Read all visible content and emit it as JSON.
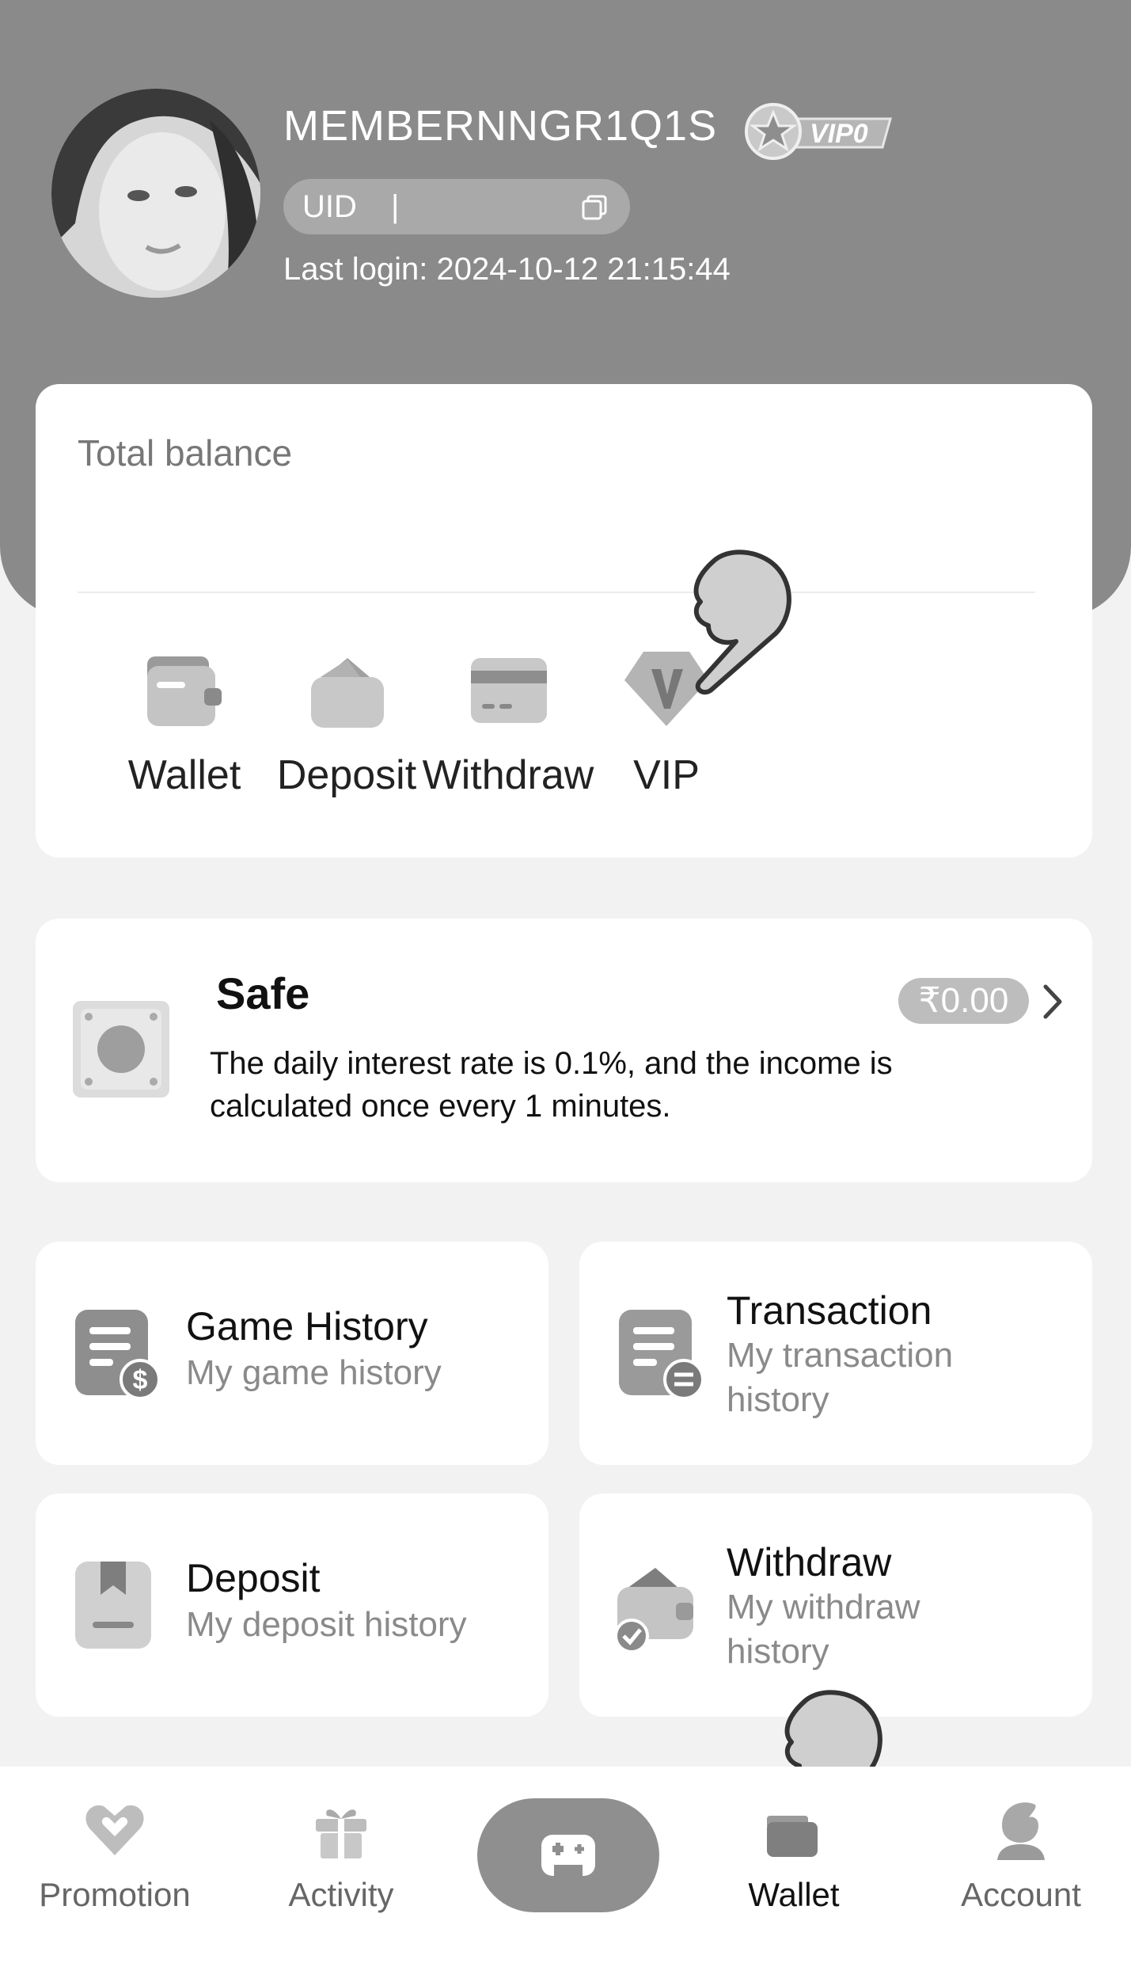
{
  "profile": {
    "username": "MEMBERNNGR1Q1S",
    "vip_badge": "VIP0",
    "uid_label": "UID",
    "uid_separator": "|",
    "last_login": "Last login: 2024-10-12 21:15:44"
  },
  "balance": {
    "label": "Total balance",
    "actions": [
      {
        "label": "Wallet",
        "icon": "wallet-icon"
      },
      {
        "label": "Deposit",
        "icon": "deposit-icon"
      },
      {
        "label": "Withdraw",
        "icon": "withdraw-card-icon"
      },
      {
        "label": "VIP",
        "icon": "vip-diamond-icon"
      }
    ]
  },
  "safe": {
    "title": "Safe",
    "amount": "₹0.00",
    "description": "The daily interest rate is 0.1%, and the income is calculated once every 1 minutes."
  },
  "history": [
    {
      "title": "Game History",
      "subtitle": "My game history",
      "icon": "game-history-icon"
    },
    {
      "title": "Transaction",
      "subtitle": "My transaction history",
      "icon": "transaction-icon"
    },
    {
      "title": "Deposit",
      "subtitle": "My deposit history",
      "icon": "deposit-history-icon"
    },
    {
      "title": "Withdraw",
      "subtitle": "My withdraw history",
      "icon": "withdraw-history-icon"
    }
  ],
  "tabbar": {
    "items": [
      {
        "label": "Promotion",
        "icon": "promotion-icon"
      },
      {
        "label": "Activity",
        "icon": "gift-icon"
      },
      {
        "label": "",
        "icon": "gamepad-icon"
      },
      {
        "label": "Wallet",
        "icon": "wallet-icon"
      },
      {
        "label": "Account",
        "icon": "account-icon"
      }
    ],
    "active": "Wallet"
  },
  "colors": {
    "header": "#8a8a8a",
    "background": "#f2f2f2",
    "card": "#ffffff",
    "muted_text": "#8a8a8a"
  }
}
